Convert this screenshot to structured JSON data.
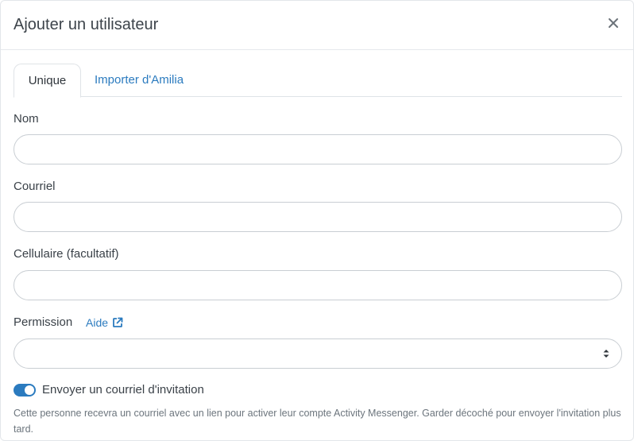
{
  "modal": {
    "title": "Ajouter un utilisateur",
    "close_icon": "close-icon"
  },
  "tabs": [
    {
      "label": "Unique",
      "active": true
    },
    {
      "label": "Importer d'Amilia",
      "active": false
    }
  ],
  "form": {
    "name": {
      "label": "Nom",
      "value": "",
      "placeholder": ""
    },
    "email": {
      "label": "Courriel",
      "value": "",
      "placeholder": ""
    },
    "phone": {
      "label": "Cellulaire (facultatif)",
      "value": "",
      "placeholder": ""
    },
    "permission": {
      "label": "Permission",
      "help_label": "Aide",
      "help_icon": "external-link-icon",
      "selected": ""
    },
    "invite": {
      "enabled": true,
      "label": "Envoyer un courriel d'invitation",
      "help_text": "Cette personne recevra un courriel avec un lien pour activer leur compte Activity Messenger. Garder décoché pour envoyer l'invitation plus tard."
    }
  },
  "colors": {
    "accent": "#2b7bbf",
    "text": "#3a4148",
    "muted": "#6c757d",
    "border": "#c9ced3"
  }
}
